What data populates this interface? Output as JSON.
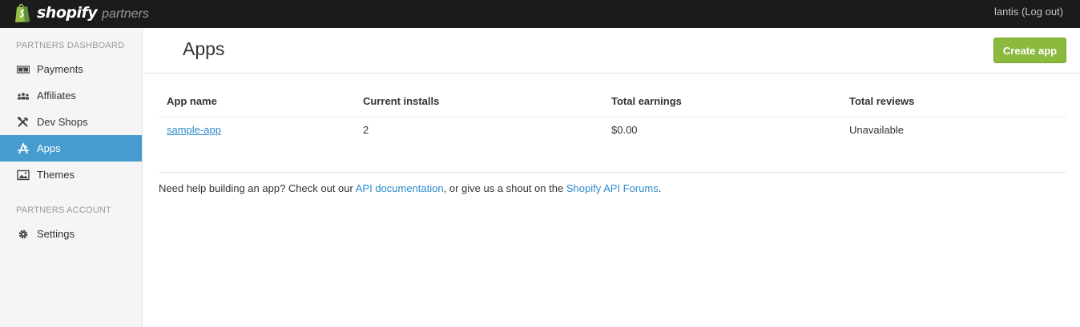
{
  "topbar": {
    "brand": "shopify",
    "brand_sub": "partners",
    "username": "lantis",
    "logout_label": "(Log out)"
  },
  "sidebar": {
    "section_dashboard": "PARTNERS DASHBOARD",
    "items": [
      {
        "label": "Payments",
        "icon": "payments-icon"
      },
      {
        "label": "Affiliates",
        "icon": "affiliates-icon"
      },
      {
        "label": "Dev Shops",
        "icon": "tools-icon"
      },
      {
        "label": "Apps",
        "icon": "apps-icon",
        "active": true
      },
      {
        "label": "Themes",
        "icon": "image-icon"
      }
    ],
    "section_account": "PARTNERS ACCOUNT",
    "account_items": [
      {
        "label": "Settings",
        "icon": "gear-icon"
      }
    ]
  },
  "main": {
    "title": "Apps",
    "create_button": "Create app",
    "table": {
      "headers": [
        "App name",
        "Current installs",
        "Total earnings",
        "Total reviews"
      ],
      "rows": [
        {
          "name": "sample-app",
          "installs": "2",
          "earnings": "$0.00",
          "reviews": "Unavailable"
        }
      ]
    },
    "help": {
      "prefix": "Need help building an app? Check out our ",
      "link1": "API documentation",
      "middle": ", or give us a shout on the ",
      "link2": "Shopify API Forums",
      "suffix": "."
    }
  },
  "colors": {
    "topbar": "#1b1b1b",
    "active_nav": "#479ccf",
    "create_button": "#8cba3e",
    "link": "#2d8ccd"
  }
}
